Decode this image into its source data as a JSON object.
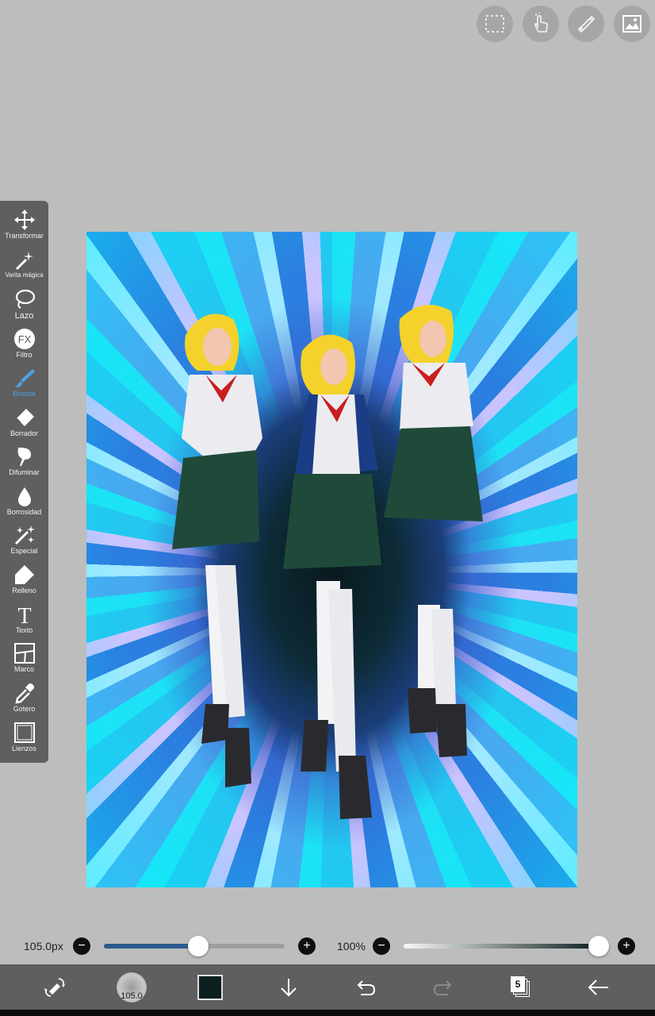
{
  "top_toolbar": {
    "icons": [
      "selection-icon",
      "touch-hand-icon",
      "ruler-icon",
      "image-icon"
    ]
  },
  "left_toolbar": {
    "tools": [
      {
        "label": "Transformar",
        "icon": "transform-arrows-icon"
      },
      {
        "label": "Varita mágica",
        "icon": "magic-wand-icon"
      },
      {
        "label": "Lazo",
        "icon": "lasso-icon"
      },
      {
        "label": "Filtro",
        "icon": "fx-filter-icon"
      },
      {
        "label": "Brocha",
        "icon": "brush-icon",
        "active": true
      },
      {
        "label": "Borrador",
        "icon": "eraser-icon"
      },
      {
        "label": "Difuminar",
        "icon": "smudge-icon"
      },
      {
        "label": "Borrosidad",
        "icon": "blur-drop-icon"
      },
      {
        "label": "Especial",
        "icon": "special-sparkle-icon"
      },
      {
        "label": "Relleno",
        "icon": "fill-bucket-icon"
      },
      {
        "label": "Texto",
        "icon": "text-t-icon"
      },
      {
        "label": "Marco",
        "icon": "frame-divider-icon"
      },
      {
        "label": "Gotero",
        "icon": "eyedropper-icon"
      },
      {
        "label": "Lienzos",
        "icon": "canvas-icon"
      }
    ],
    "active_color": "#4aa3e8"
  },
  "brush_size": {
    "value_label": "105.0px",
    "level": 0.52,
    "minus": "−",
    "plus": "+"
  },
  "opacity": {
    "value_label": "100%",
    "level": 1.0,
    "minus": "−",
    "plus": "+"
  },
  "bottom_bar": {
    "brush_preview_label": "105.0",
    "current_color": "#0c1f1f",
    "layer_count": "5",
    "icons": [
      "swap-tools-icon",
      "brush-preview-icon",
      "color-swatch-icon",
      "download-arrow-icon",
      "undo-icon",
      "redo-icon",
      "layers-icon",
      "back-arrow-icon"
    ]
  },
  "colors": {
    "toolbar_bg": "#5f5f5f",
    "workspace_bg": "#bdbdbd",
    "slider_fill": "#2d5a8e"
  }
}
